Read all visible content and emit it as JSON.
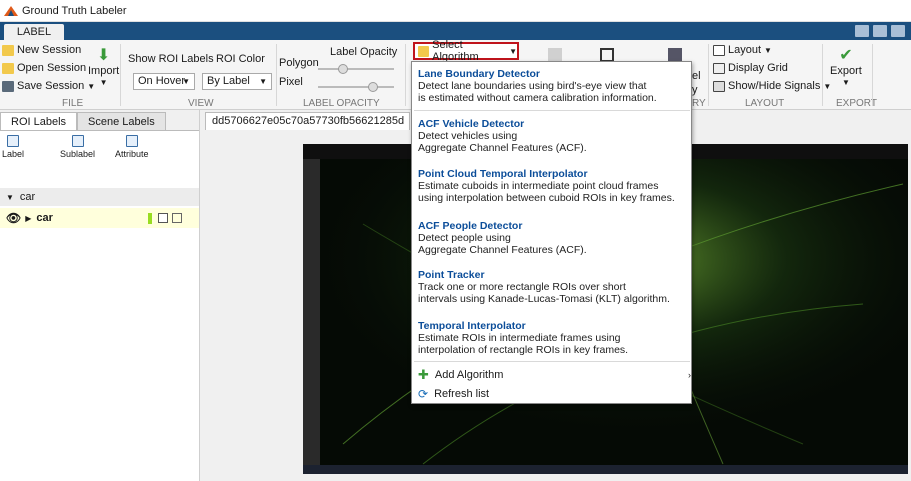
{
  "window": {
    "title": "Ground Truth Labeler"
  },
  "ribbon_tab": {
    "label": "LABEL"
  },
  "file_group": {
    "new_session": "New Session",
    "open_session": "Open Session",
    "save_session": "Save Session",
    "import": "Import",
    "label": "FILE"
  },
  "view_group": {
    "show_roi_labels": "Show ROI Labels",
    "roi_color": "ROI Color",
    "show_value": "On Hover",
    "color_value": "By Label",
    "label": "VIEW"
  },
  "opacity_group": {
    "polygon": "Polygon",
    "label_opacity": "Label Opacity",
    "pixel": "Pixel",
    "label": "LABEL OPACITY"
  },
  "automate": {
    "select_algorithm": "Select Algorithm"
  },
  "right_groups": {
    "layout": "Layout",
    "display_grid": "Display Grid",
    "show_hide_signals": "Show/Hide Signals",
    "export": "Export",
    "layout_label": "LAYOUT",
    "export_label": "EXPORT",
    "partial_label": "el",
    "partial_y": "y",
    "partial_ry": "RY"
  },
  "left_panel": {
    "tabs": [
      "ROI Labels",
      "Scene Labels"
    ],
    "tools": [
      "Label",
      "Sublabel",
      "Attribute"
    ],
    "category": "car",
    "item": "car"
  },
  "document": {
    "tab": "dd5706627e05c70a57730fb56621285d"
  },
  "algorithms": [
    {
      "name": "Lane Boundary Detector",
      "desc": [
        "Detect lane boundaries using bird's-eye view that",
        "is estimated without camera calibration information."
      ]
    },
    {
      "name": "ACF Vehicle Detector",
      "desc": [
        "Detect vehicles using",
        "Aggregate Channel Features (ACF)."
      ]
    },
    {
      "name": "Point Cloud Temporal Interpolator",
      "desc": [
        "Estimate cuboids in intermediate point cloud frames",
        "using interpolation between cuboid ROIs in key frames."
      ]
    },
    {
      "name": "ACF People Detector",
      "desc": [
        "Detect people using",
        "Aggregate Channel Features (ACF)."
      ]
    },
    {
      "name": "Point Tracker",
      "desc": [
        "Track one or more rectangle ROIs over short",
        "intervals using Kanade-Lucas-Tomasi (KLT) algorithm."
      ]
    },
    {
      "name": "Temporal Interpolator",
      "desc": [
        "Estimate ROIs in intermediate frames using",
        "interpolation of rectangle ROIs in key frames."
      ]
    }
  ],
  "actions": {
    "add_algorithm": "Add Algorithm",
    "refresh_list": "Refresh list"
  },
  "colors": {
    "accent": "#1b4f7f",
    "highlight_border": "#c0141c",
    "link": "#0b4d99",
    "label_swatch": "#99dd22"
  }
}
